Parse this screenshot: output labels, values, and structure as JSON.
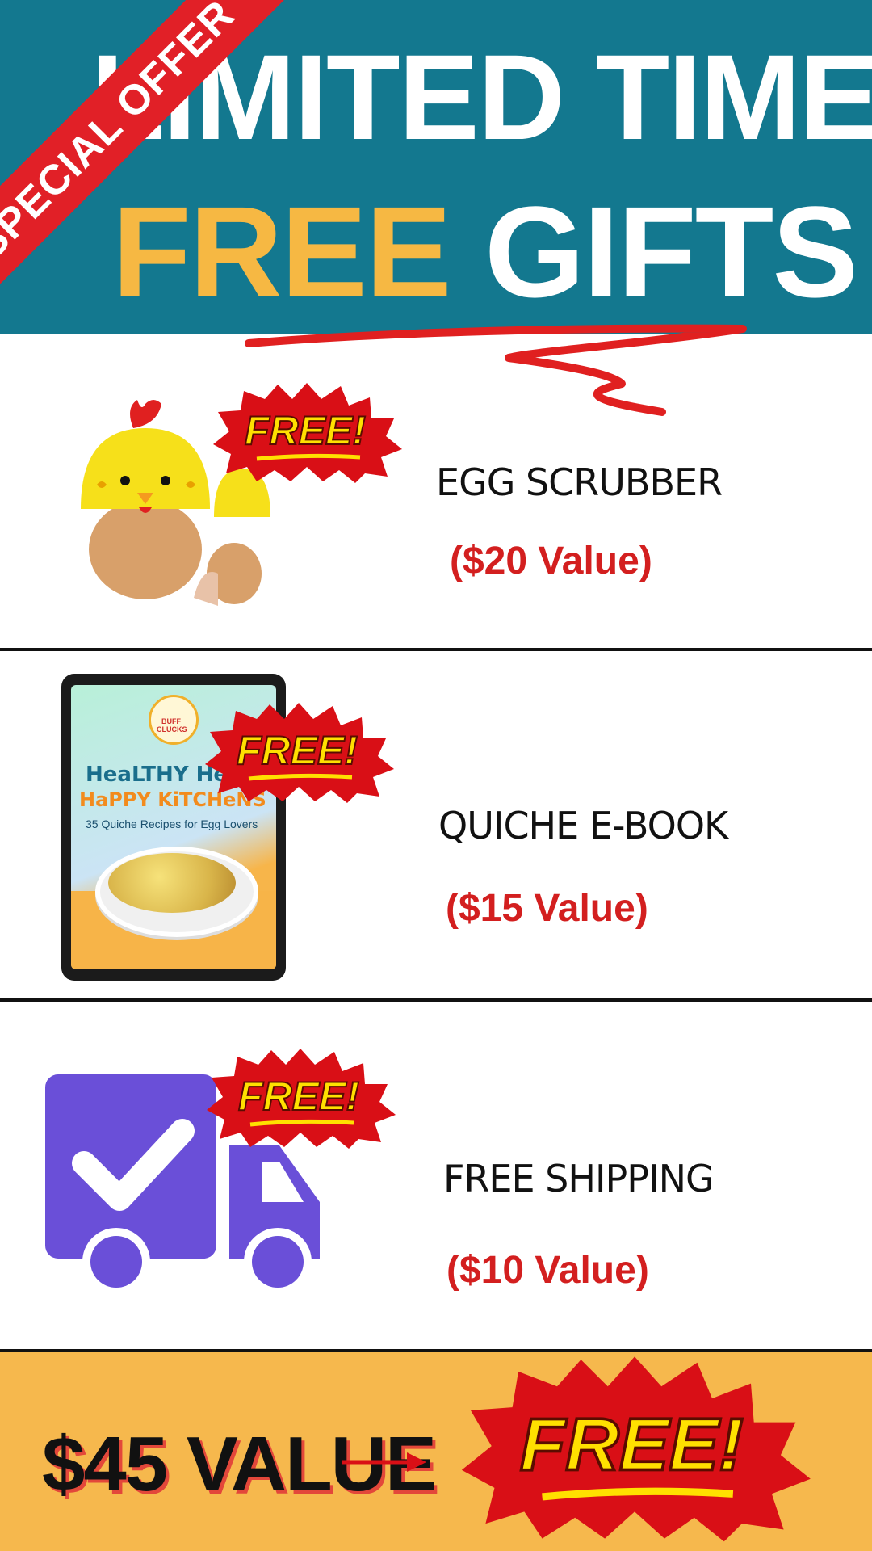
{
  "header": {
    "line1": "LIMITED TIME",
    "line2_highlight": "FREE",
    "line2_rest": " GIFTS",
    "ribbon": "SPECIAL OFFER"
  },
  "items": [
    {
      "name": "EGG SCRUBBER",
      "value": "($20 Value)",
      "badge": "FREE!",
      "icon": "chicken-egg-scrubber"
    },
    {
      "name": "QUICHE E-BOOK",
      "value": "($15 Value)",
      "badge": "FREE!",
      "icon": "ebook-tablet",
      "ebook": {
        "brand": "BUFF CLUCKS",
        "title1": "HeaLTHY He",
        "title2": "HaPPY KiTCHeNS",
        "subtitle": "35 Quiche Recipes for Egg Lovers"
      }
    },
    {
      "name": "FREE SHIPPING",
      "value": "($10 Value)",
      "badge": "FREE!",
      "icon": "delivery-truck-check"
    }
  ],
  "footer": {
    "total": "$45 VALUE",
    "badge": "FREE!"
  },
  "colors": {
    "header_bg": "#13788f",
    "accent_yellow": "#f6b843",
    "ribbon_red": "#e12027",
    "value_red": "#d31f1f",
    "truck_purple": "#6a4fd8",
    "footer_bg": "#f6b84d"
  }
}
